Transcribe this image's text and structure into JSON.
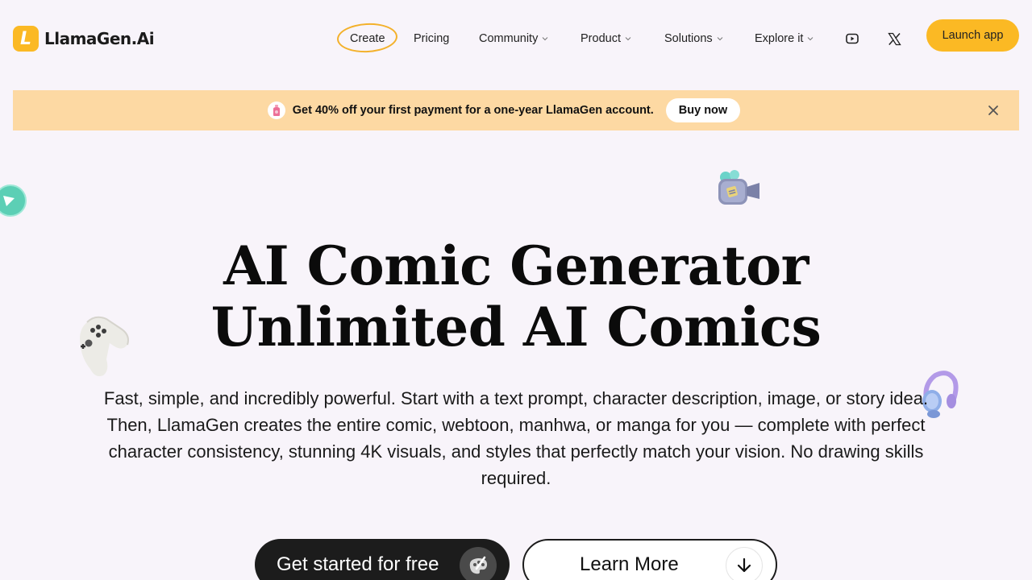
{
  "brand": {
    "name": "LlamaGen.Ai",
    "logo_letter": "L",
    "accent": "#fbb924"
  },
  "nav": {
    "items": [
      {
        "label": "Create",
        "dropdown": false,
        "highlighted": true
      },
      {
        "label": "Pricing",
        "dropdown": false
      },
      {
        "label": "Community",
        "dropdown": true
      },
      {
        "label": "Product",
        "dropdown": true
      },
      {
        "label": "Solutions",
        "dropdown": true
      },
      {
        "label": "Explore it",
        "dropdown": true
      }
    ],
    "social": [
      "youtube-icon",
      "x-icon"
    ],
    "launch_label": "Launch app"
  },
  "banner": {
    "text": "Get 40% off your first payment for a one-year LlamaGen account.",
    "button": "Buy now",
    "background": "#fdd9a3"
  },
  "hero": {
    "title_line1": "AI Comic Generator",
    "title_line2": "Unlimited AI Comics",
    "description": "Fast, simple, and incredibly powerful. Start with a text prompt, character description, image, or story idea. Then, LlamaGen creates the entire comic, webtoon, manhwa, or manga for you — complete with perfect character consistency, stunning 4K visuals, and styles that perfectly match your vision. No drawing skills required.",
    "cta_primary": "Get started for free",
    "cta_secondary": "Learn More"
  }
}
